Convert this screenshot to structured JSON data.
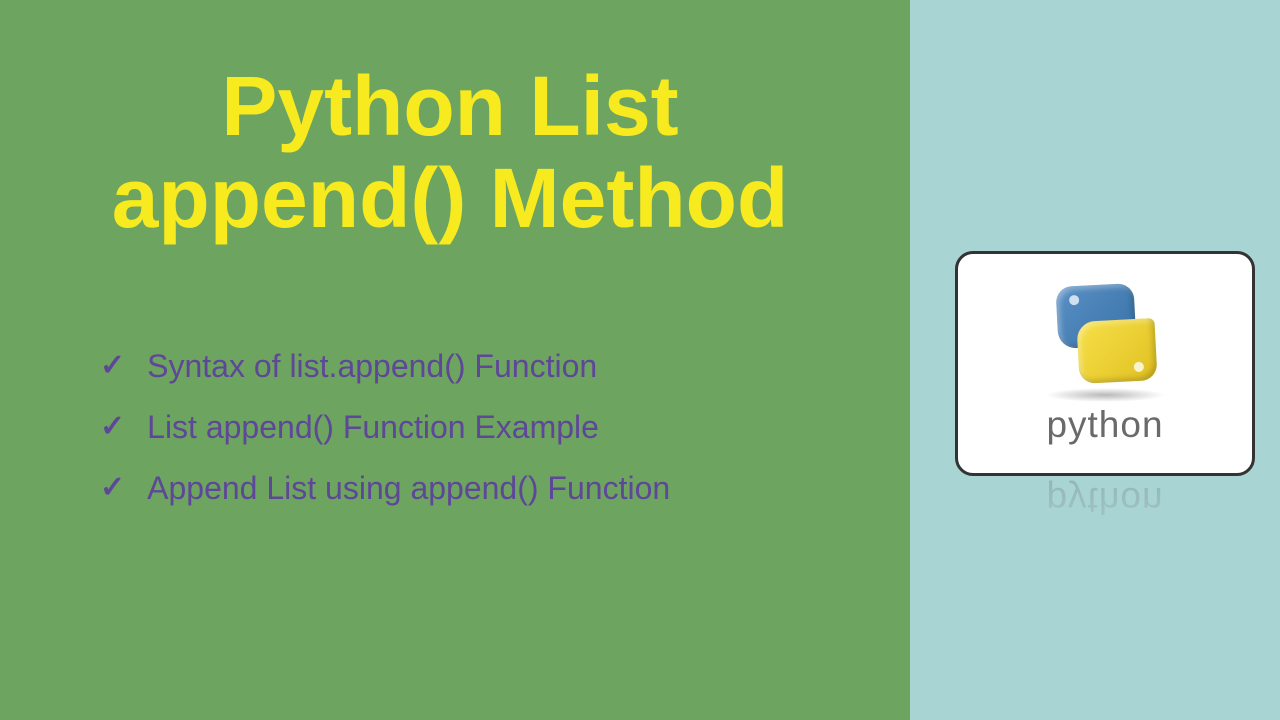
{
  "title_line1": "Python List",
  "title_line2": "append() Method",
  "bullets": [
    "Syntax of list.append() Function",
    "List append() Function Example",
    "Append List using append() Function"
  ],
  "logo_text": "python"
}
